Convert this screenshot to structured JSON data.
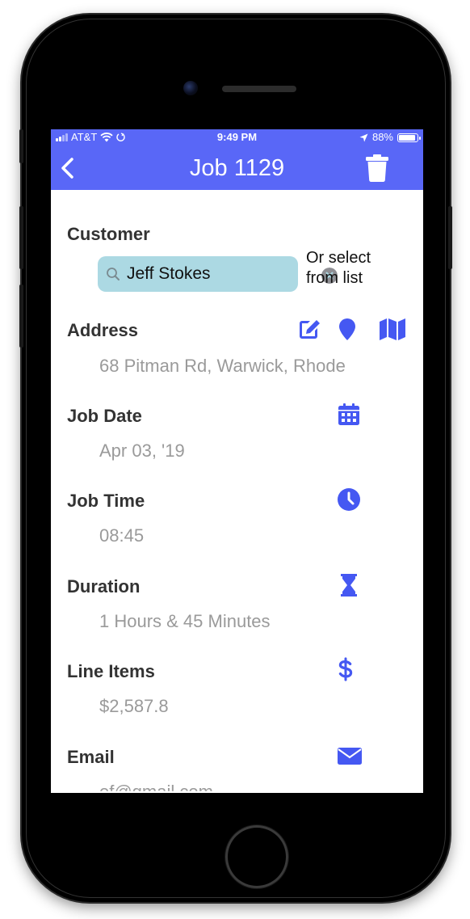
{
  "status_bar": {
    "carrier": "AT&T",
    "time": "9:49 PM",
    "battery": "88%",
    "battery_level": 0.88
  },
  "nav": {
    "title": "Job 1129",
    "back_icon": "chevron-left-icon",
    "trash_icon": "trash-icon"
  },
  "customer": {
    "label": "Customer",
    "search_value": "Jeff Stokes",
    "select_hint_line1": "Or select",
    "select_hint_line2": "from list"
  },
  "address": {
    "label": "Address",
    "value": "68 Pitman Rd, Warwick, Rhode",
    "icons": [
      "edit-icon",
      "location-pin-icon",
      "map-icon"
    ]
  },
  "job_date": {
    "label": "Job Date",
    "value": "Apr 03, '19",
    "icon": "calendar-icon"
  },
  "job_time": {
    "label": "Job Time",
    "value": "08:45",
    "icon": "clock-icon"
  },
  "duration": {
    "label": "Duration",
    "value": "1 Hours & 45 Minutes",
    "icon": "hourglass-icon"
  },
  "line_items": {
    "label": "Line Items",
    "value": "$2,587.8",
    "icon": "dollar-icon"
  },
  "email": {
    "label": "Email",
    "value": "ef@gmail.com",
    "icon": "envelope-icon"
  },
  "colors": {
    "accent": "#5967f7",
    "search_bg": "#acd9e3",
    "label": "#333333",
    "value": "#9a9a9a"
  }
}
